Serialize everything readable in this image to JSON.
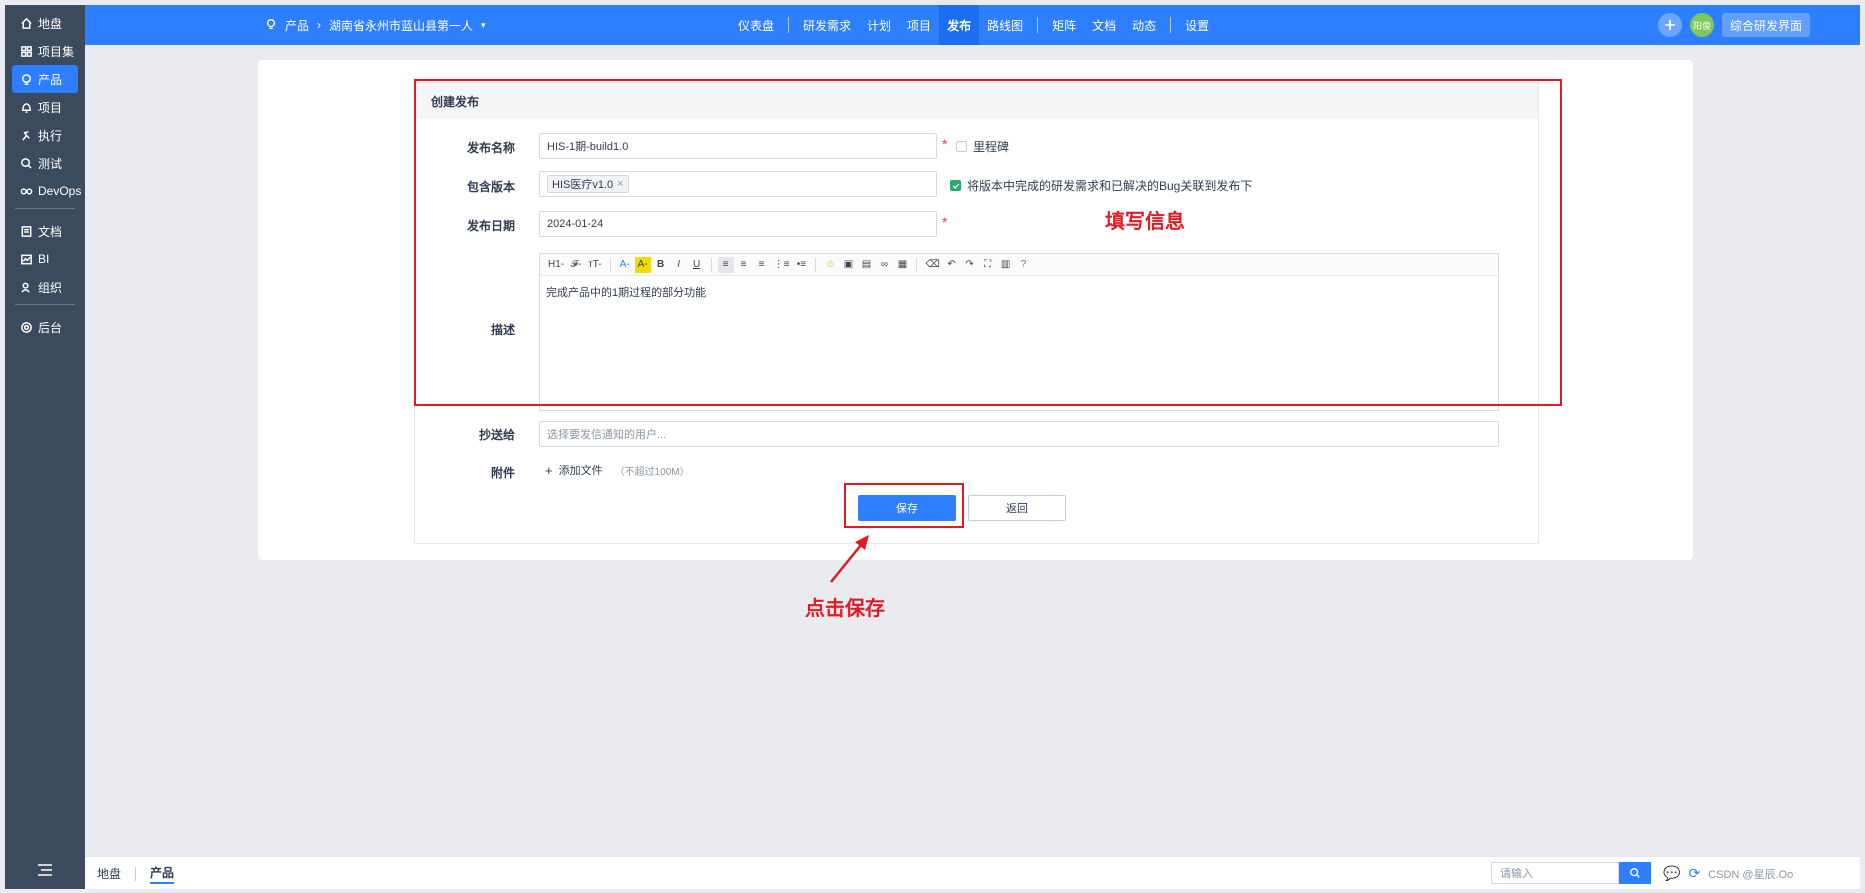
{
  "sidebar": {
    "items": [
      {
        "label": "地盘",
        "icon": "home-icon"
      },
      {
        "label": "项目集",
        "icon": "grid-icon"
      },
      {
        "label": "产品",
        "icon": "lightbulb-icon"
      },
      {
        "label": "项目",
        "icon": "bell-icon"
      },
      {
        "label": "执行",
        "icon": "run-icon"
      },
      {
        "label": "测试",
        "icon": "search-icon"
      },
      {
        "label": "DevOps",
        "icon": "infinity-icon"
      },
      {
        "label": "文档",
        "icon": "doc-icon"
      },
      {
        "label": "BI",
        "icon": "chart-icon"
      },
      {
        "label": "组织",
        "icon": "people-icon"
      },
      {
        "label": "后台",
        "icon": "gear-icon"
      }
    ],
    "active": "产品"
  },
  "header": {
    "breadcrumb_root": "产品",
    "breadcrumb_product": "湖南省永州市蓝山县第一人",
    "nav": [
      "仪表盘",
      "研发需求",
      "计划",
      "项目",
      "发布",
      "路线图",
      "矩阵",
      "文档",
      "动态",
      "设置"
    ],
    "active_nav": "发布",
    "avatar_text": "阳俊",
    "switch_label": "综合研发界面"
  },
  "form": {
    "title": "创建发布",
    "name_label": "发布名称",
    "name_value": "HIS-1期-build1.0",
    "milestone_label": "里程碑",
    "build_label": "包含版本",
    "build_tag": "HIS医疗v1.0",
    "link_label": "将版本中完成的研发需求和已解决的Bug关联到发布下",
    "date_label": "发布日期",
    "date_value": "2024-01-24",
    "desc_label": "描述",
    "desc_value": "完成产品中的1期过程的部分功能",
    "mailto_label": "抄送给",
    "mailto_placeholder": "选择要发信通知的用户...",
    "files_label": "附件",
    "add_file": "添加文件",
    "file_limit": "（不超过100M）",
    "save_label": "保存",
    "back_label": "返回"
  },
  "editor_toolbar": [
    "H1-",
    "𝓕-",
    "тT-",
    "A-",
    "A-",
    "B",
    "I",
    "U"
  ],
  "annotations": {
    "fill_info": "填写信息",
    "click_save": "点击保存"
  },
  "footer": {
    "crumbs": [
      "地盘",
      "产品"
    ],
    "search_placeholder": "请输入",
    "watermark": "CSDN @星辰.Oo"
  },
  "colors": {
    "brand": "#2e7fff",
    "sidebar": "#3c4a5e",
    "annotation": "#e01b24"
  }
}
